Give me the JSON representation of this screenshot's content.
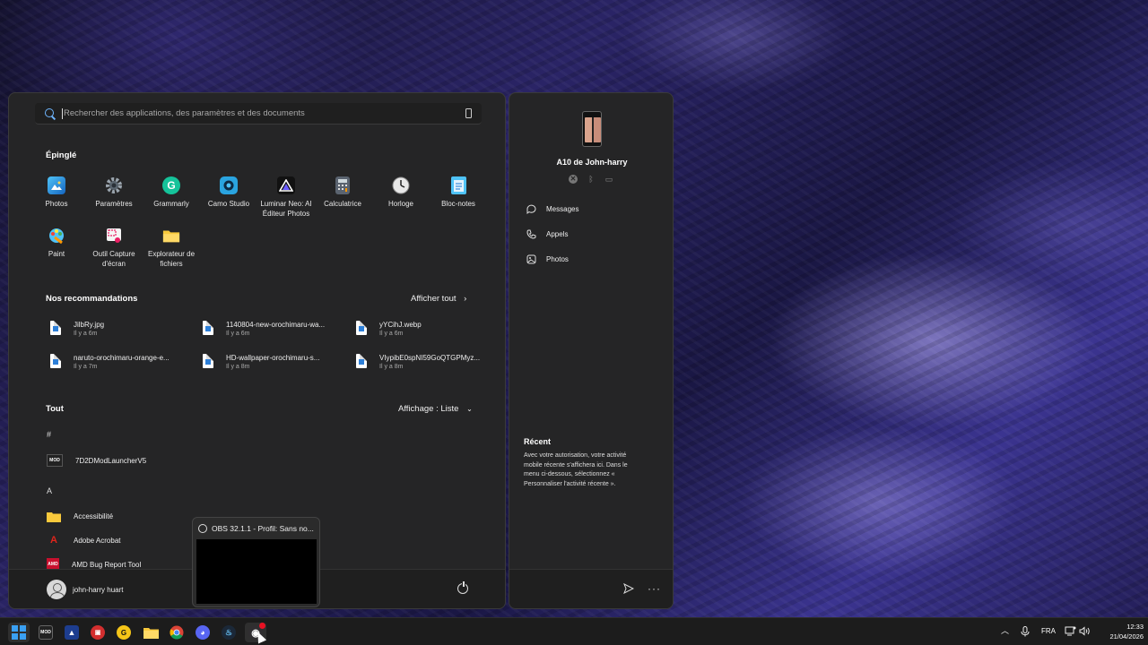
{
  "search": {
    "placeholder": "Rechercher des applications, des paramètres et des documents"
  },
  "pinned": {
    "title": "Épinglé",
    "apps": [
      {
        "label": "Photos",
        "icon": "photos-icon"
      },
      {
        "label": "Paramètres",
        "icon": "gear-icon"
      },
      {
        "label": "Grammarly",
        "icon": "grammarly-icon",
        "glyph": "G"
      },
      {
        "label": "Camo Studio",
        "icon": "camo-icon"
      },
      {
        "label": "Luminar Neo: AI Éditeur Photos",
        "icon": "luminar-icon"
      },
      {
        "label": "Calculatrice",
        "icon": "calculator-icon"
      },
      {
        "label": "Horloge",
        "icon": "clock-icon"
      },
      {
        "label": "Bloc-notes",
        "icon": "notepad-icon"
      },
      {
        "label": "Paint",
        "icon": "paint-icon"
      },
      {
        "label": "Outil Capture d'écran",
        "icon": "snipping-tool-icon"
      },
      {
        "label": "Explorateur de fichiers",
        "icon": "folder-icon"
      }
    ]
  },
  "recommendations": {
    "title": "Nos recommandations",
    "show_all": "Afficher tout",
    "items": [
      {
        "name": "JilbRy.jpg",
        "time": "Il y a 6m"
      },
      {
        "name": "1140804-new-orochimaru-wa...",
        "time": "Il y a 6m"
      },
      {
        "name": "yYCihJ.webp",
        "time": "Il y a 6m"
      },
      {
        "name": "naruto-orochimaru-orange-e...",
        "time": "Il y a 7m"
      },
      {
        "name": "HD-wallpaper-orochimaru-s...",
        "time": "Il y a 8m"
      },
      {
        "name": "VIypibE0spNI59GoQTGPMyz...",
        "time": "Il y a 8m"
      }
    ]
  },
  "all_apps": {
    "title": "Tout",
    "view_toggle": "Affichage : Liste",
    "groups": [
      {
        "letter": "#",
        "items": [
          {
            "label": "7D2DModLauncherV5",
            "icon": "mod-launcher-icon",
            "glyph": "MOD"
          }
        ]
      },
      {
        "letter": "A",
        "items": [
          {
            "label": "Accessibilité",
            "icon": "folder-icon"
          },
          {
            "label": "Adobe Acrobat",
            "icon": "acrobat-icon",
            "glyph": "A"
          },
          {
            "label": "AMD Bug Report Tool",
            "icon": "amd-icon",
            "glyph": "AMD"
          }
        ]
      }
    ]
  },
  "user": {
    "name": "john-harry huart"
  },
  "obs_preview": {
    "title": "OBS 32.1.1 - Profil: Sans no..."
  },
  "phone": {
    "device_name": "A10 de John-harry",
    "nav": [
      {
        "label": "Messages",
        "icon": "chat-icon",
        "glyph": "💬"
      },
      {
        "label": "Appels",
        "icon": "phone-call-icon",
        "glyph": "✆"
      },
      {
        "label": "Photos",
        "icon": "image-icon",
        "glyph": "▣"
      }
    ],
    "recent_title": "Récent",
    "recent_text": "Avec votre autorisation, votre activité mobile récente s'affichera ici. Dans le menu ci-dessous, sélectionnez « Personnaliser l'activité récente »."
  },
  "taskbar": {
    "language": "FRA",
    "time": "12:33",
    "date": "21/04/2026",
    "apps": [
      {
        "icon": "windows-start-icon"
      },
      {
        "icon": "mod-launcher-icon",
        "glyph": "MOD"
      },
      {
        "icon": "app-icon",
        "glyph": "▲"
      },
      {
        "icon": "app-icon-red",
        "glyph": "▣"
      },
      {
        "icon": "app-icon-yellow",
        "glyph": "G"
      },
      {
        "icon": "file-explorer-icon"
      },
      {
        "icon": "chrome-icon"
      },
      {
        "icon": "discord-icon",
        "glyph": "◕"
      },
      {
        "icon": "steam-icon",
        "glyph": "♨"
      },
      {
        "icon": "obs-icon",
        "glyph": "◉"
      }
    ]
  },
  "colors": {
    "accent": "#3aa0f3",
    "menu_bg": "#252526",
    "taskbar_bg": "#1c1c1c"
  }
}
